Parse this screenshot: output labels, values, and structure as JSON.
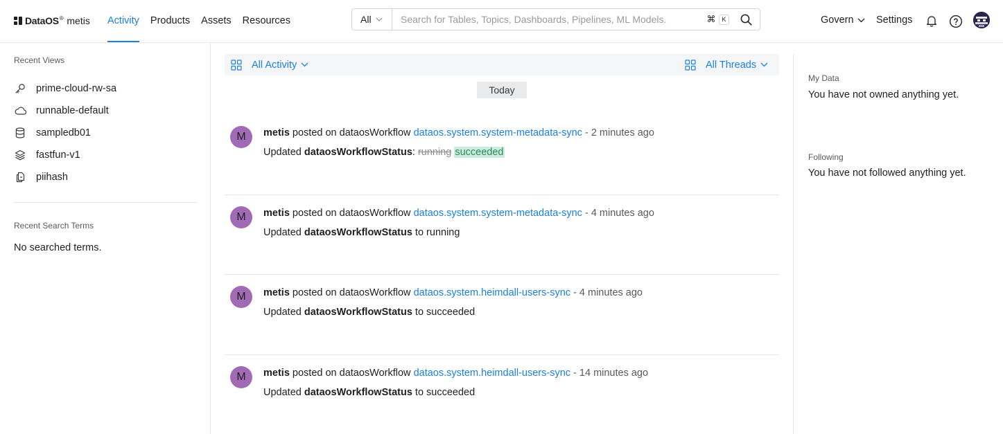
{
  "header": {
    "logo": {
      "brand": "DataOS",
      "registered": "®",
      "product": "metis"
    },
    "nav": [
      {
        "label": "Activity",
        "active": true
      },
      {
        "label": "Products",
        "active": false
      },
      {
        "label": "Assets",
        "active": false
      },
      {
        "label": "Resources",
        "active": false
      }
    ],
    "search": {
      "scope": "All",
      "placeholder": "Search for Tables, Topics, Dashboards, Pipelines, ML Models.",
      "shortcut_mod": "⌘",
      "shortcut_key": "K"
    },
    "govern_label": "Govern",
    "settings_label": "Settings"
  },
  "sidebar": {
    "recent_views_label": "Recent Views",
    "recent_views": [
      {
        "label": "prime-cloud-rw-sa",
        "icon": "key-icon"
      },
      {
        "label": "runnable-default",
        "icon": "cloud-icon"
      },
      {
        "label": "sampledb01",
        "icon": "database-icon"
      },
      {
        "label": "fastfun-v1",
        "icon": "layers-icon"
      },
      {
        "label": "piihash",
        "icon": "file-copy-icon"
      }
    ],
    "recent_search_label": "Recent Search Terms",
    "no_terms": "No searched terms."
  },
  "main": {
    "activity_filter": "All Activity",
    "threads_filter": "All Threads",
    "date_label": "Today",
    "feed": [
      {
        "avatar": "M",
        "author": "metis",
        "action": "posted on dataosWorkflow",
        "entity": "dataos.system.system-metadata-sync",
        "separator": " - ",
        "time": "2 minutes ago",
        "update_prefix": "Updated",
        "field": "dataosWorkflowStatus",
        "colon": ":",
        "connector": "",
        "old_value": "running",
        "new_value": "succeeded",
        "plain_value": ""
      },
      {
        "avatar": "M",
        "author": "metis",
        "action": "posted on dataosWorkflow",
        "entity": "dataos.system.system-metadata-sync",
        "separator": " - ",
        "time": "4 minutes ago",
        "update_prefix": "Updated",
        "field": "dataosWorkflowStatus",
        "colon": "",
        "connector": "to",
        "old_value": "",
        "new_value": "",
        "plain_value": "running"
      },
      {
        "avatar": "M",
        "author": "metis",
        "action": "posted on dataosWorkflow",
        "entity": "dataos.system.heimdall-users-sync",
        "separator": " - ",
        "time": "4 minutes ago",
        "update_prefix": "Updated",
        "field": "dataosWorkflowStatus",
        "colon": "",
        "connector": "to",
        "old_value": "",
        "new_value": "",
        "plain_value": "succeeded"
      },
      {
        "avatar": "M",
        "author": "metis",
        "action": "posted on dataosWorkflow",
        "entity": "dataos.system.heimdall-users-sync",
        "separator": " - ",
        "time": "14 minutes ago",
        "update_prefix": "Updated",
        "field": "dataosWorkflowStatus",
        "colon": "",
        "connector": "to",
        "old_value": "",
        "new_value": "",
        "plain_value": "succeeded"
      }
    ]
  },
  "right_panel": {
    "my_data_label": "My Data",
    "my_data_text": "You have not owned anything yet.",
    "following_label": "Following",
    "following_text": "You have not followed anything yet."
  },
  "colors": {
    "accent": "#1b7fe0",
    "avatar_bg": "#a16ab5",
    "diff_added_bg": "#c9ecdd",
    "diff_added_text": "#2f8a63"
  }
}
